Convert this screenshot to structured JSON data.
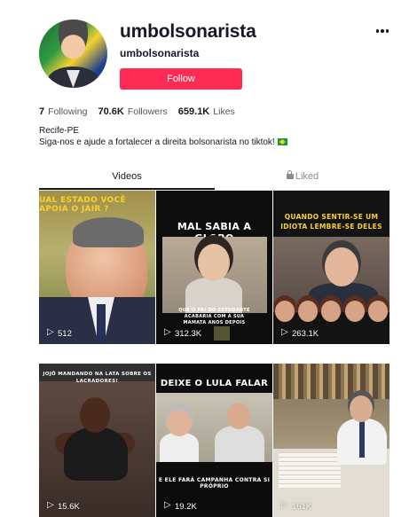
{
  "profile": {
    "username": "umbolsonarista",
    "nickname": "umbolsonarista",
    "follow_label": "Follow",
    "accent_color": "#fe2c55"
  },
  "stats": {
    "following_count": "7",
    "following_label": "Following",
    "followers_count": "70.6K",
    "followers_label": "Followers",
    "likes_count": "659.1K",
    "likes_label": "Likes"
  },
  "bio": {
    "line1": "Recife-PE",
    "line2": "Siga-nos e ajude a fortalecer a direita bolsonarista no tiktok!"
  },
  "tabs": {
    "videos": "Videos",
    "liked": "Liked"
  },
  "videos": [
    {
      "caption": "UAL ESTADO VOCÊ APOIA O JAIR ?",
      "views": "512"
    },
    {
      "caption": "MAL SABIA A GLOBO",
      "subcaption": "QUE O PAI DO ESTUDANTE ACABARIA COM A SUA MAMATA ANOS DEPOIS",
      "views": "312.3K"
    },
    {
      "caption": "QUANDO SENTIR-SE UM IDIOTA LEMBRE-SE DELES",
      "views": "263.1K"
    },
    {
      "caption": "JOJÔ MANDANDO NA LATA SOBRE OS LACRADORES!",
      "views": "15.6K"
    },
    {
      "caption": "DEIXE O LULA FALAR",
      "subcaption": "E ELE FARÁ CAMPANHA CONTRA SI PRÓPRIO",
      "views": "19.2K"
    },
    {
      "caption": "",
      "views": "161K"
    }
  ]
}
